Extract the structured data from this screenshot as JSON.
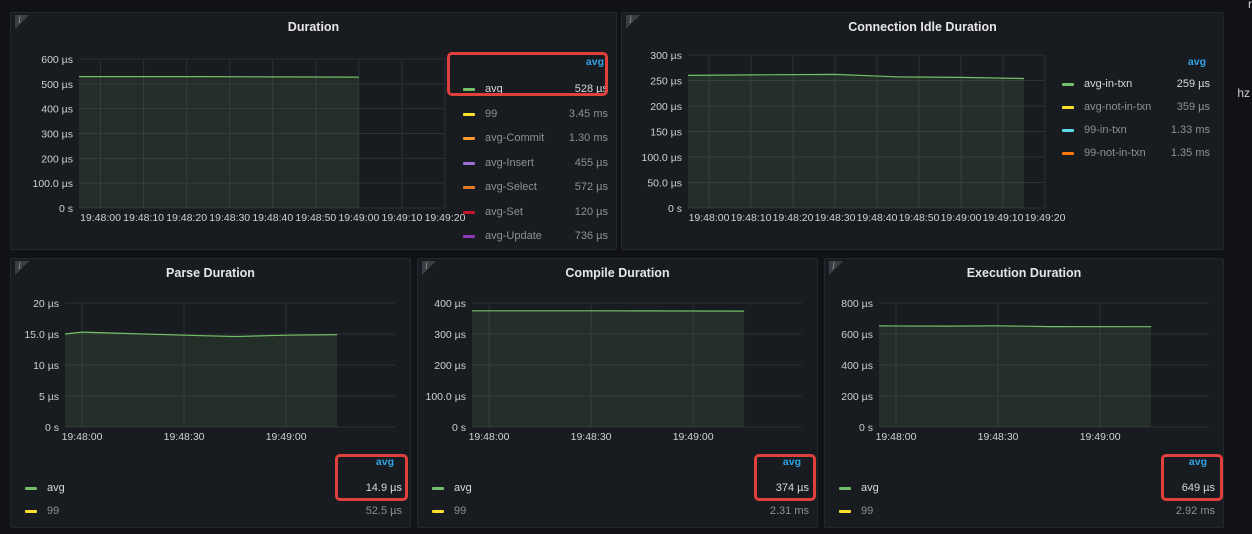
{
  "colors": {
    "avg": "#73bf69",
    "p99": "#fade2a",
    "avg_commit": "#ff9830",
    "avg_insert": "#a16fd1",
    "avg_select": "#e07a24",
    "avg_set": "#c4162a",
    "avg_update": "#8f3bb8",
    "in_txn_99": "#5ed9e9",
    "not_in_txn_99": "#ff780a",
    "legend_header": "#33a2e5",
    "highlight": "#e0413d"
  },
  "icons": {
    "panel_info": "info-icon"
  },
  "edge_text": {
    "top_right": "r",
    "right": "hz"
  },
  "panels": [
    {
      "id": "duration",
      "title": "Duration",
      "info_glyph": "i",
      "legend_header": "avg",
      "legend": [
        {
          "name": "avg",
          "value": "528 µs",
          "color_key": "avg"
        },
        {
          "name": "99",
          "value": "3.45 ms",
          "color_key": "p99"
        },
        {
          "name": "avg-Commit",
          "value": "1.30 ms",
          "color_key": "avg_commit"
        },
        {
          "name": "avg-Insert",
          "value": "455 µs",
          "color_key": "avg_insert"
        },
        {
          "name": "avg-Select",
          "value": "572 µs",
          "color_key": "avg_select"
        },
        {
          "name": "avg-Set",
          "value": "120 µs",
          "color_key": "avg_set"
        },
        {
          "name": "avg-Update",
          "value": "736 µs",
          "color_key": "avg_update"
        }
      ]
    },
    {
      "id": "idle",
      "title": "Connection Idle Duration",
      "info_glyph": "i",
      "legend_header": "avg",
      "legend": [
        {
          "name": "avg-in-txn",
          "value": "259 µs",
          "color_key": "avg"
        },
        {
          "name": "avg-not-in-txn",
          "value": "359 µs",
          "color_key": "p99"
        },
        {
          "name": "99-in-txn",
          "value": "1.33 ms",
          "color_key": "in_txn_99"
        },
        {
          "name": "99-not-in-txn",
          "value": "1.35 ms",
          "color_key": "not_in_txn_99"
        }
      ]
    },
    {
      "id": "parse",
      "title": "Parse Duration",
      "info_glyph": "i",
      "legend_header": "avg",
      "legend": [
        {
          "name": "avg",
          "value": "14.9 µs",
          "color_key": "avg"
        },
        {
          "name": "99",
          "value": "52.5 µs",
          "color_key": "p99"
        }
      ]
    },
    {
      "id": "compile",
      "title": "Compile Duration",
      "info_glyph": "i",
      "legend_header": "avg",
      "legend": [
        {
          "name": "avg",
          "value": "374 µs",
          "color_key": "avg"
        },
        {
          "name": "99",
          "value": "2.31 ms",
          "color_key": "p99"
        }
      ]
    },
    {
      "id": "execution",
      "title": "Execution Duration",
      "info_glyph": "i",
      "legend_header": "avg",
      "legend": [
        {
          "name": "avg",
          "value": "649 µs",
          "color_key": "avg"
        },
        {
          "name": "99",
          "value": "2.92 ms",
          "color_key": "p99"
        }
      ]
    }
  ],
  "chart_data": [
    {
      "panel": "duration",
      "type": "area",
      "title": "Duration",
      "y_unit": "µs",
      "ylim": [
        0,
        600
      ],
      "y_ticks": [
        0,
        100,
        200,
        300,
        400,
        500,
        600
      ],
      "y_tick_labels": [
        "0 s",
        "100.0 µs",
        "200 µs",
        "300 µs",
        "400 µs",
        "500 µs",
        "600 µs"
      ],
      "x_ticks": [
        "19:48:00",
        "19:48:10",
        "19:48:20",
        "19:48:30",
        "19:48:40",
        "19:48:50",
        "19:49:00",
        "19:49:10",
        "19:49:20"
      ],
      "grid": true,
      "series": [
        {
          "name": "avg",
          "x": [
            "19:47:55",
            "19:48:10",
            "19:48:25",
            "19:48:40",
            "19:49:00"
          ],
          "y": [
            529,
            529,
            529,
            528,
            527
          ]
        }
      ]
    },
    {
      "panel": "idle",
      "type": "area",
      "title": "Connection Idle Duration",
      "y_unit": "µs",
      "ylim": [
        0,
        300
      ],
      "y_ticks": [
        0,
        50,
        100,
        150,
        200,
        250,
        300
      ],
      "y_tick_labels": [
        "0 s",
        "50.0 µs",
        "100.0 µs",
        "150 µs",
        "200 µs",
        "250 µs",
        "300 µs"
      ],
      "x_ticks": [
        "19:48:00",
        "19:48:10",
        "19:48:20",
        "19:48:30",
        "19:48:40",
        "19:48:50",
        "19:49:00",
        "19:49:10",
        "19:49:20"
      ],
      "grid": true,
      "series": [
        {
          "name": "avg-in-txn",
          "x": [
            "19:47:55",
            "19:48:10",
            "19:48:30",
            "19:48:45",
            "19:49:00",
            "19:49:15"
          ],
          "y": [
            260,
            261,
            262,
            257,
            256,
            254
          ]
        }
      ]
    },
    {
      "panel": "parse",
      "type": "area",
      "title": "Parse Duration",
      "y_unit": "µs",
      "ylim": [
        0,
        20
      ],
      "y_ticks": [
        0,
        5,
        10,
        15,
        20
      ],
      "y_tick_labels": [
        "0 s",
        "5 µs",
        "10 µs",
        "15.0 µs",
        "20 µs"
      ],
      "x_ticks": [
        "19:48:00",
        "19:48:30",
        "19:49:00"
      ],
      "grid": true,
      "series": [
        {
          "name": "avg",
          "x": [
            "19:47:55",
            "19:48:00",
            "19:48:30",
            "19:48:45",
            "19:49:00",
            "19:49:15"
          ],
          "y": [
            15.0,
            15.3,
            14.8,
            14.6,
            14.8,
            14.9
          ]
        }
      ]
    },
    {
      "panel": "compile",
      "type": "area",
      "title": "Compile Duration",
      "y_unit": "µs",
      "ylim": [
        0,
        400
      ],
      "y_ticks": [
        0,
        100,
        200,
        300,
        400
      ],
      "y_tick_labels": [
        "0 s",
        "100.0 µs",
        "200 µs",
        "300 µs",
        "400 µs"
      ],
      "x_ticks": [
        "19:48:00",
        "19:48:30",
        "19:49:00"
      ],
      "grid": true,
      "series": [
        {
          "name": "avg",
          "x": [
            "19:47:55",
            "19:48:30",
            "19:49:15"
          ],
          "y": [
            375,
            375,
            374
          ]
        }
      ]
    },
    {
      "panel": "execution",
      "type": "area",
      "title": "Execution Duration",
      "y_unit": "µs",
      "ylim": [
        0,
        800
      ],
      "y_ticks": [
        0,
        200,
        400,
        600,
        800
      ],
      "y_tick_labels": [
        "0 s",
        "200 µs",
        "400 µs",
        "600 µs",
        "800 µs"
      ],
      "x_ticks": [
        "19:48:00",
        "19:48:30",
        "19:49:00"
      ],
      "grid": true,
      "series": [
        {
          "name": "avg",
          "x": [
            "19:47:55",
            "19:48:15",
            "19:48:30",
            "19:48:45",
            "19:49:15"
          ],
          "y": [
            652,
            651,
            653,
            648,
            647
          ]
        }
      ]
    }
  ]
}
